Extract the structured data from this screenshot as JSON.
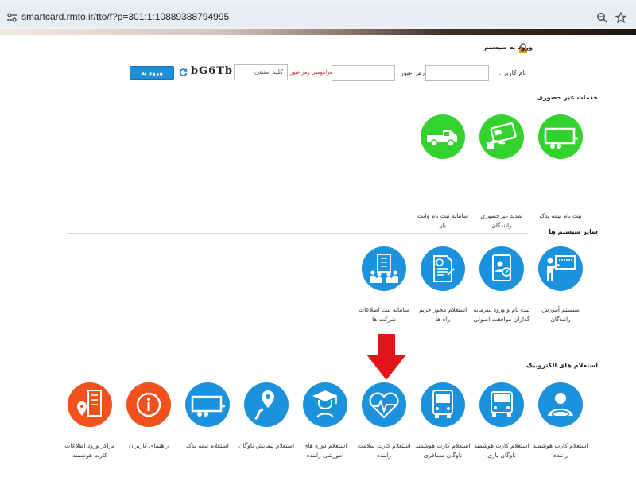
{
  "browser": {
    "url": "smartcard.rmto.ir/tto/f?p=301:1:10889388794995",
    "icons": [
      "tune-icon",
      "zoom-icon",
      "star-icon"
    ]
  },
  "login": {
    "title": "ورود به سیستم",
    "username_label": "نام کاربر :",
    "password_label": "رمز عبور :",
    "captcha_placeholder": "کلید امنیتی",
    "forgot_link": "فراموشی رمز عبور",
    "captcha_text": "bG6Tb",
    "submit_label": "ورود به سیستم"
  },
  "sections": {
    "offline": {
      "title": "خدمات غیر حضوری",
      "items": [
        {
          "label": "ثبت نام نیمه یدک",
          "icon": "trailer-icon",
          "color": "#35d22f"
        },
        {
          "label": "تمدید غیرحضوری رانندگان",
          "icon": "smartcard-icon",
          "color": "#35d22f"
        },
        {
          "label": "سامانه ثبت نام وانت بار",
          "icon": "pickup-truck-icon",
          "color": "#35d22f"
        }
      ]
    },
    "other": {
      "title": "سایر سیستم ها",
      "items": [
        {
          "label": "سیستم آموزش رانندگان",
          "icon": "teacher-board-icon",
          "color": "#1d92dc"
        },
        {
          "label": "ثبت نام و ورود سرمایه گذاران موافقت اصولی",
          "icon": "tablet-user-icon",
          "color": "#1d92dc"
        },
        {
          "label": "استعلام مجوز حریم راه ها",
          "icon": "document-stamp-icon",
          "color": "#1d92dc"
        },
        {
          "label": "سامانه ثبت اطلاعات شرکت ها",
          "icon": "company-building-icon",
          "color": "#1d92dc"
        }
      ]
    },
    "inquiries": {
      "title": "استعلام های الکترونیک",
      "items": [
        {
          "label": "استعلام کارت هوشمند راننده",
          "icon": "driver-icon",
          "color": "#1d92dc"
        },
        {
          "label": "استعلام کارت هوشمند ناوگان باری",
          "icon": "truck-front-icon",
          "color": "#1d92dc"
        },
        {
          "label": "استعلام کارت هوشمند ناوگان مسافری",
          "icon": "bus-front-icon",
          "color": "#1d92dc"
        },
        {
          "label": "استعلام کارت سلامت راننده",
          "icon": "heart-pulse-icon",
          "color": "#1d92dc"
        },
        {
          "label": "استعلام دوره های آموزشی راننده",
          "icon": "graduate-icon",
          "color": "#1d92dc"
        },
        {
          "label": "استعلام پیمایش ناوگان",
          "icon": "route-pin-icon",
          "color": "#1d92dc"
        },
        {
          "label": "استعلام نیمه یدک",
          "icon": "trailer-icon",
          "color": "#1d92dc"
        },
        {
          "label": "راهنمای کاربران",
          "icon": "info-icon",
          "color": "#f3501f"
        },
        {
          "label": "مراکز ورود اطلاعات کارت هوشمند",
          "icon": "building-pin-icon",
          "color": "#f3501f"
        }
      ]
    }
  }
}
